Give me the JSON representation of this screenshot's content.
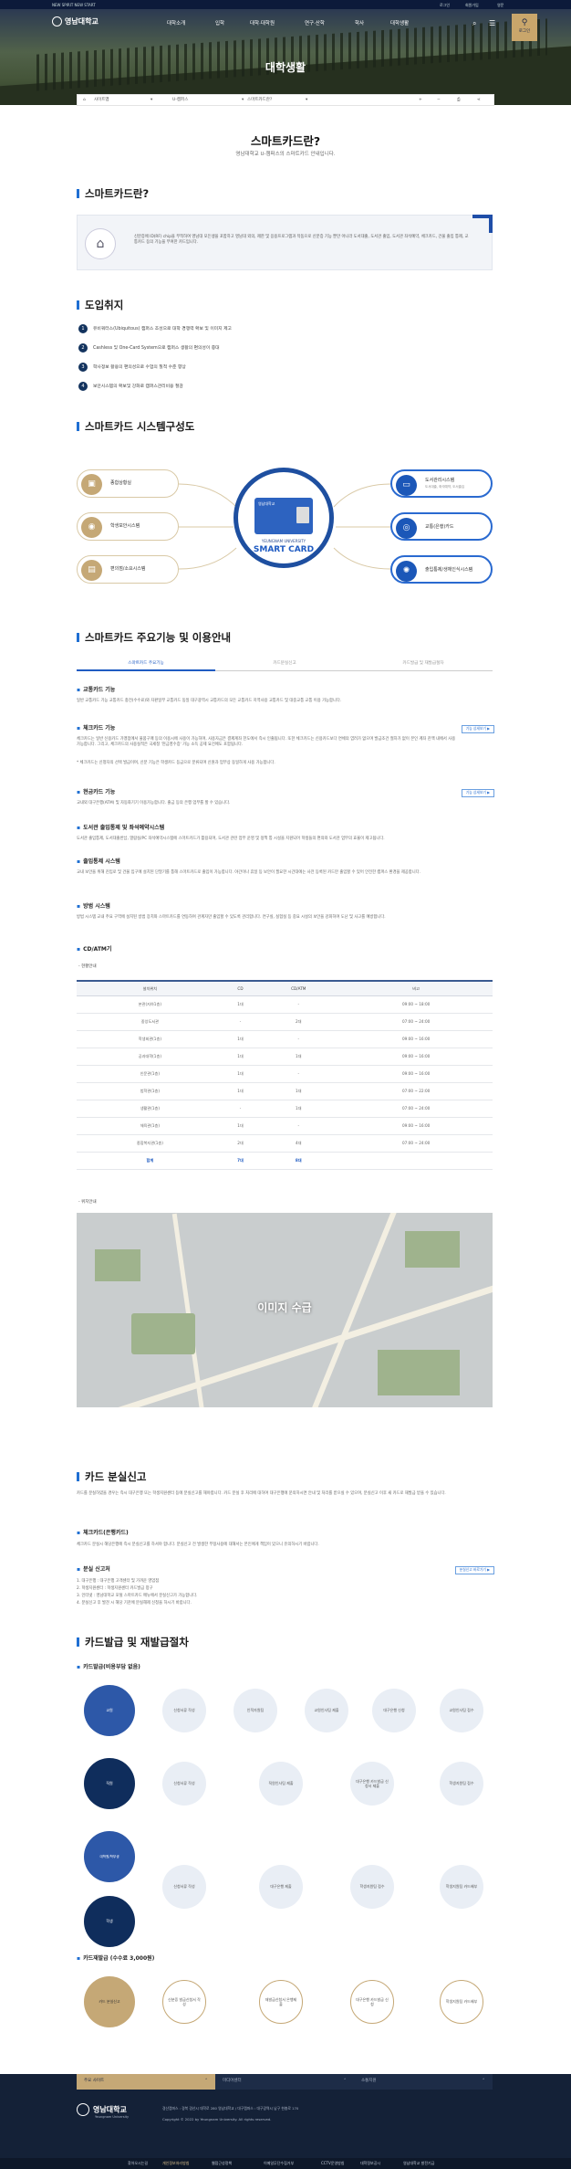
{
  "topbar": {
    "left": "NEW SPIRIT NEW START",
    "links": [
      "로그인",
      "회원가입",
      "영문"
    ]
  },
  "header": {
    "logo": "영남대학교",
    "menu": [
      "대학소개",
      "입학",
      "대학·대학원",
      "연구·산학",
      "학사",
      "대학생활"
    ],
    "login_label": "로그인"
  },
  "hero": {
    "title": "대학생활"
  },
  "breadcrumb": {
    "home": "사이트맵",
    "level1": "U-캠퍼스",
    "level2": "스마트카드란?"
  },
  "page": {
    "title": "스마트카드란?",
    "subtitle": "영남대학교 U-캠퍼스의 스마트카드 안내입니다."
  },
  "intro": {
    "heading": "스마트카드란?",
    "body": "신분증에 ID(RF) chip을 부착하여 영남대 모든생을 포함하고 영남대 외의, 제한 및 응용프로그램과 작동으로 신분증 기능 뿐만 아니라 도서대출, 도서관 출입, 도서관 좌석예약, 체크카드, 건물 출입 통제, 교통카드 등의 기능을 부여한 카드입니다."
  },
  "purpose": {
    "heading": "도입취지",
    "items": [
      "유비쿼터스(Ubiquitous) 캠퍼스 조성으로 대학 경쟁력 확보 및 이미지 제고",
      "Cashless 및 One-Card System으로 캠퍼스 생활의 편의성이 증대",
      "학사정보 활용의 편의성으로 수업의 질적 수준 향상",
      "보안시스템의 확보및 강화로 캠퍼스관리비용 절감"
    ]
  },
  "system": {
    "heading": "스마트카드 시스템구성도",
    "left": [
      "종합상황실",
      "학생보안시스템",
      "편의점/소요시스템"
    ],
    "right": [
      "도서관리시스템",
      "교통(은행)카드",
      "출입통제/생체인식시스템"
    ],
    "center_sub": "YEUNGNAM UNIVERSITY",
    "center_title": "SMART CARD",
    "card_name": "영남대학교",
    "right_sub0": "도서대출, 좌석예약, 도서출입"
  },
  "features": {
    "heading": "스마트카드 주요기능 및 이용안내",
    "tabs": [
      "스마트카드 주요기능",
      "카드분실신고",
      "카드발급 및 재발급절차"
    ],
    "items": [
      {
        "title": "교통카드 기능",
        "body": "일반 교통카드 기능 교통카드 충전(수수료)와 자판일부 교통카드 동일 대구광역시 교통카드의 모든 교통카드 지역사용 교통카드 및 대중교통 교통 이용 가능합니다."
      },
      {
        "title": "체크카드 기능",
        "body": "체크카드는 일반 신용카드 가맹점에서 물품구매 등의 이용시에 사용이 가능하며, 사용자금은 결제계좌 한도에서 즉시 인출됩니다. 또한 체크카드는 신용카드보다 연체의 염려가 없으며 발급조건 절차가 없이 본인 계좌 잔액 내에서 사용 가능합니다. 그리고, 체크카드의 사용실적은 국세청 '현금영수증' 가능 소득 공제 요건에도 포함됩니다.",
        "button": "기능 상세보기 ▶",
        "note": "* 체크카드는 신청자의 선택 발급이며, 신분 기능은 학생카드 등급으로 분류되며 신원과 업무상 동일하게 사용 가능합니다."
      },
      {
        "title": "현금카드 기능",
        "body": "교내외 대구은행(ATM) 및 자동화기기 이용가능합니다. 출금 등의 은행 업무를 할 수 있습니다.",
        "button": "기능 상세보기 ▶"
      },
      {
        "title": "도서관 출입통제 및 좌석예약시스템",
        "body": "도서관 출입통제, 도서대출반납, 열람실/PC 좌석예약시스템에 스마트카드가 활용되며, 도서관 관련 업무 운영 및 정책 통 시설을 지원되어 학생들의 편의와 도서관 업무의 효율이 제고됩니다."
      },
      {
        "title": "출입통제 시스템",
        "body": "교내 보안을 위해 진입로 및 건물 입구에 설치된 단말기를 통해 스마트카드로 출입이 가능합니다. 야간이나 휴일 등 보안이 필요한 시간대에는 사전 등록된 카드만 출입할 수 있어 안전한 캠퍼스 환경을 제공합니다."
      },
      {
        "title": "방범 시스템",
        "body": "방범 시스템 교내 주요 구역에 설치된 방범 장치와 스마트카드를 연동하여 관계자만 출입할 수 있도록 관리합니다. 연구실, 실험실 등 중요 시설의 보안을 강화하여 도난 및 사고를 예방합니다."
      },
      {
        "title": "CD/ATM기"
      }
    ]
  },
  "atm": {
    "label": "현황안내",
    "headers": [
      "설치위치",
      "CD",
      "CD/ATM",
      "비고"
    ],
    "rows": [
      [
        "본관(지하1층)",
        "1대",
        "-",
        "09:00 ~ 18:00"
      ],
      [
        "중앙도서관",
        "-",
        "2대",
        "07:00 ~ 24:00"
      ],
      [
        "학생회관(1층)",
        "1대",
        "-",
        "09:00 ~ 16:00"
      ],
      [
        "공과대학(1층)",
        "1대",
        "1대",
        "09:00 ~ 16:00"
      ],
      [
        "인문관(1층)",
        "1대",
        "-",
        "09:00 ~ 16:00"
      ],
      [
        "법학관(1층)",
        "1대",
        "1대",
        "07:00 ~ 22:00"
      ],
      [
        "생활관(1층)",
        "-",
        "1대",
        "07:00 ~ 24:00"
      ],
      [
        "체육관(1층)",
        "1대",
        "-",
        "09:00 ~ 16:00"
      ],
      [
        "종합복지관(1층)",
        "2대",
        "4대",
        "07:00 ~ 24:00"
      ]
    ],
    "total": [
      "합계",
      "7대",
      "8대",
      ""
    ]
  },
  "map": {
    "label": "위치안내",
    "placeholder": "이미지 수급"
  },
  "lost": {
    "heading": "카드 분실신고",
    "intro": "카드를 분실하였을 경우는 즉시 대구은행 또는 학생지원센터 등에 분실신고를 해야합니다. 카드 분실 후 처리에 대하여 대구은행에 문의하시면 안내 및 처리를 받으실 수 있으며, 분실신고 이후 새 카드로 재발급 받을 수 있습니다.",
    "check_title": "체크카드(은행카드)",
    "check_body": "체크카드 분실시 해당은행에 즉시 분실신고를 하셔야 합니다. 분실신고 전 발생한 부정사용에 대해서는 본인에게 책임이 있으니 유의하시기 바랍니다.",
    "report_title": "분실 신고처",
    "button": "분실신고 바로가기 ▶",
    "report_items": [
      "1. 대구은행 : 대구은행 고객센터 및 가까운 영업점",
      "2. 학생지원센터 : 학생지원센터 카드발급 창구",
      "3. 인터넷 : 영남대학교 포털 스마트카드 메뉴에서 분실신고가 가능합니다.",
      "4. 분실신고 후 발견 시 해당 기관에 분실해제 신청을 하시기 바랍니다."
    ]
  },
  "issue": {
    "heading": "카드발급 및 재발급절차",
    "new_title": "카드발급(비용부담 없음)",
    "rows": [
      [
        "교원",
        "신청서류 작성",
        "인적자원팀",
        "교원인사팀 제출",
        "대구은행 신청",
        "교원인사팀 접수"
      ],
      [
        "직원",
        "신청서류 작성",
        "직원인사팀 제출",
        "대구은행 카드발급 신청서 제출",
        "학생지원팀 접수"
      ],
      [
        "대학원/학부생",
        "학생",
        "신청서류 작성",
        "대구은행 제출",
        "학생지원팀 접수",
        "학생지원팀 카드배부"
      ]
    ],
    "re_title": "카드재발급 (수수료 3,000원)",
    "re_row": [
      "카드 분실신고",
      "신분증 발급신청서 작성",
      "재발급신청서 은행제출",
      "대구은행 카드발급 신청",
      "학생지원팀 카드배부"
    ]
  },
  "footer": {
    "bar": [
      "주요 사이트",
      "미디어센터",
      "소통지원"
    ],
    "logo": "영남대학교",
    "logo_en": "Yeungnam University",
    "address": "경산캠퍼스 : 경북 경산시 대학로 280 영남대학교 / 대구캠퍼스 : 대구광역시 남구 현충로 170",
    "copyright": "Copyright © 2022 by Yeungnam University. All rights reserved.",
    "menu": [
      "찾아오시는길",
      "개인정보처리방침",
      "웹접근성정책",
      "이메일무단수집거부",
      "CCTV운영방침",
      "대학정보공시",
      "영남대학교 발전기금"
    ]
  }
}
